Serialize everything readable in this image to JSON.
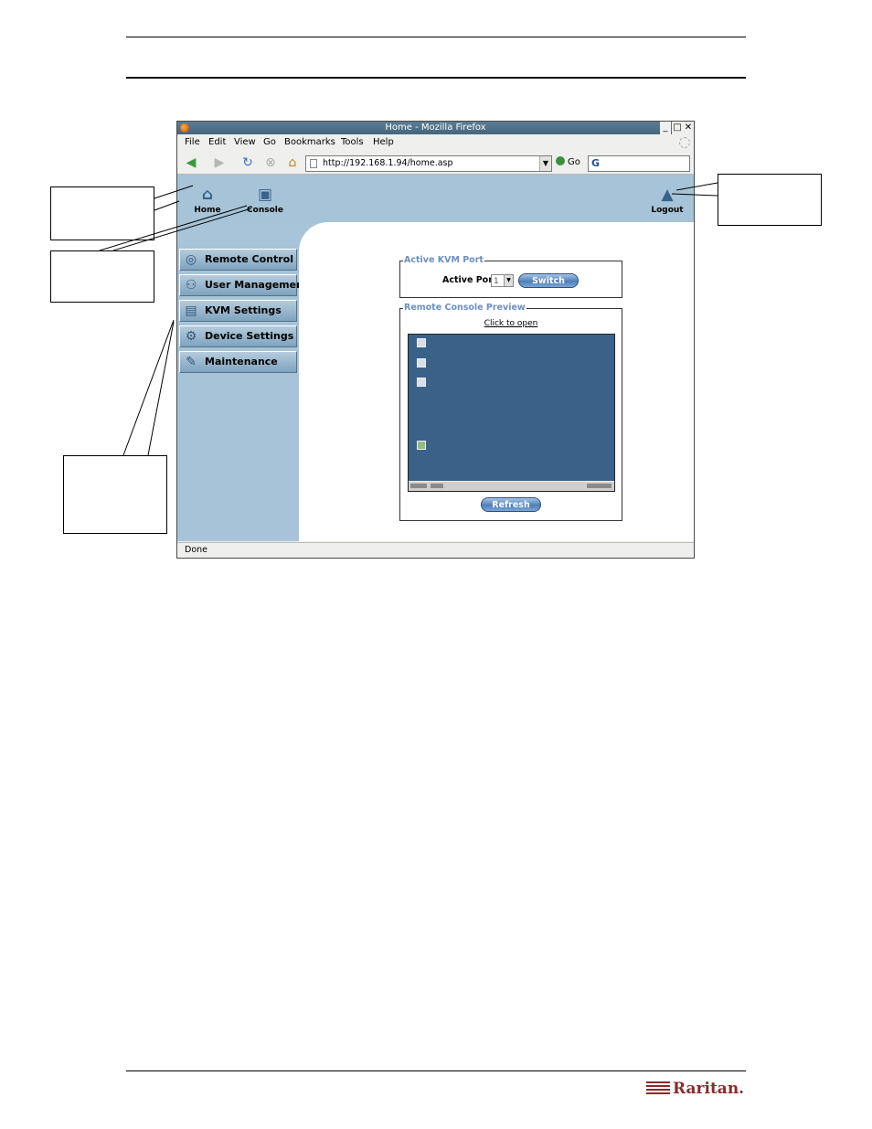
{
  "browser": {
    "title": "Home - Mozilla Firefox",
    "menu": [
      "File",
      "Edit",
      "View",
      "Go",
      "Bookmarks",
      "Tools",
      "Help"
    ],
    "url": "http://192.168.1.94/home.asp",
    "go_label": "Go",
    "status": "Done",
    "window_buttons": [
      "_",
      "□",
      "✕"
    ]
  },
  "top_nav": {
    "home_label": "Home",
    "console_label": "Console",
    "logout_label": "Logout"
  },
  "sidebar": {
    "items": [
      {
        "label": "Remote Control",
        "icon": "magnifier-icon"
      },
      {
        "label": "User Management",
        "icon": "users-icon"
      },
      {
        "label": "KVM Settings",
        "icon": "keyboard-icon"
      },
      {
        "label": "Device Settings",
        "icon": "gears-icon"
      },
      {
        "label": "Maintenance",
        "icon": "wrench-icon"
      }
    ]
  },
  "kvm_port": {
    "legend": "Active KVM Port",
    "port_label": "Active Port",
    "selected_port": "1",
    "switch_label": "Switch"
  },
  "preview": {
    "legend": "Remote Console Preview",
    "click_to_open": "Click to open",
    "refresh_label": "Refresh"
  },
  "colors": {
    "page_bg": "#a8c4d8",
    "legend_text": "#6d8fc4",
    "desktop": "#3a6288",
    "brand": "#862c2c"
  },
  "footer": {
    "logo_text": "Raritan."
  }
}
